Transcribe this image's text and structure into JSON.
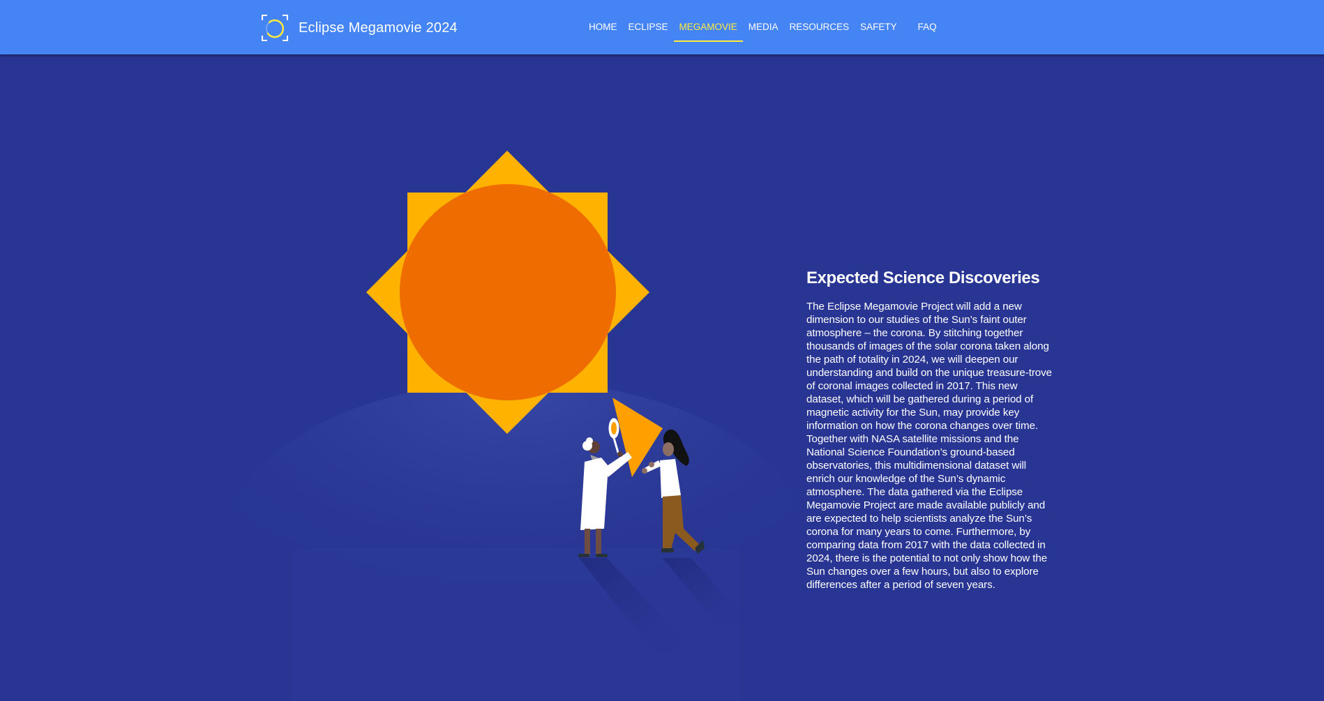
{
  "header": {
    "brand_title": "Eclipse Megamovie 2024",
    "brand_icon": "eclipse-logo-icon",
    "nav": [
      {
        "label": "HOME",
        "active": false
      },
      {
        "label": "ECLIPSE",
        "active": false
      },
      {
        "label": "MEGAMOVIE",
        "active": true
      },
      {
        "label": "MEDIA",
        "active": false
      },
      {
        "label": "RESOURCES",
        "active": false
      },
      {
        "label": "SAFETY",
        "active": false
      },
      {
        "label": "FAQ",
        "active": false
      }
    ]
  },
  "main": {
    "heading": "Expected Science Discoveries",
    "body": "The Eclipse Megamovie Project will add a new dimension to our studies of the Sun’s faint outer atmosphere – the corona. By stitching together thousands of images of the solar corona taken along the path of totality in 2024, we will deepen our understanding and build on the unique treasure-trove of coronal images collected in 2017. This new dataset, which will be gathered during a period of magnetic activity for the Sun, may provide key information on how the corona changes over time. Together with NASA satellite missions and the National Science Foundation’s ground-based observatories, this multidimensional dataset will enrich our knowledge of the Sun’s dynamic atmosphere. The data gathered via the Eclipse Megamovie Project are made available publicly and are expected to help scientists analyze the Sun’s corona for many years to come. Furthermore, by comparing data from 2017 with the data collected in 2024, there is the potential to not only show how the Sun changes over a few hours, but also to explore differences after a period of seven years."
  },
  "colors": {
    "header_bg": "#4584f5",
    "page_bg": "#283593",
    "active_nav": "#ffeb3b",
    "sun_rays": "#ffb300",
    "sun_disk": "#ef6c00"
  }
}
